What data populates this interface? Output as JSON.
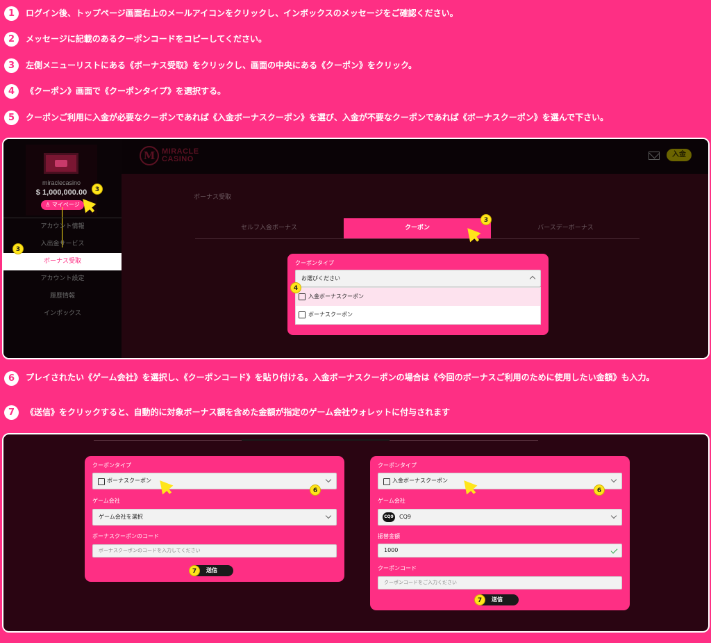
{
  "steps": [
    {
      "num": "1",
      "text": "ログイン後、トップページ画面右上のメールアイコンをクリックし、インボックスのメッセージをご確認ください。"
    },
    {
      "num": "2",
      "text": "メッセージに記載のあるクーポンコードをコピーしてください。"
    },
    {
      "num": "3",
      "text": "左側メニューリストにある《ボーナス受取》をクリックし、画面の中央にある《クーポン》をクリック。"
    },
    {
      "num": "4",
      "text": "《クーポン》画面で《クーポンタイプ》を選択する。"
    },
    {
      "num": "5",
      "text": "クーポンご利用に入金が必要なクーポンであれば《入金ボーナスクーポン》を選び、入金が不要なクーポンであれば《ボーナスクーポン》を選んで下さい。"
    },
    {
      "num": "6",
      "text": "プレイされたい《ゲーム会社》を選択し、《クーポンコード》を貼り付ける。入金ボーナスクーポンの場合は《今回のボーナスご利用のために使用したい金額》も入力。"
    },
    {
      "num": "7",
      "text": "《送信》をクリックすると、自動的に対象ボーナス額を含めた金額が指定のゲーム会社ウォレットに付与されます"
    }
  ],
  "screen1": {
    "brand_line1": "MIRACLE",
    "brand_line2": "CASINO",
    "deposit_label": "入金",
    "username": "miraclecasino",
    "balance": "$ 1,000,000.00",
    "mypage_label": "♙ マイページ",
    "menu": [
      "アカウント情報",
      "入出金サービス",
      "ボーナス受取",
      "アカウント設定",
      "履歴情報",
      "インボックス"
    ],
    "page_title": "ボーナス受取",
    "tabs": [
      "セルフ入金ボーナス",
      "クーポン",
      "バースデーボーナス"
    ],
    "coupon_type_label": "クーポンタイプ",
    "select_placeholder": "お選びください",
    "options": [
      "入金ボーナスクーポン",
      "ボーナスクーポン"
    ],
    "badges": {
      "profile": "3",
      "menu": "3",
      "tab": "3",
      "dropdown": "4"
    }
  },
  "screen2": {
    "left": {
      "coupon_type_label": "クーポンタイプ",
      "coupon_type_value": "ボーナスクーポン",
      "game_label": "ゲーム会社",
      "game_value": "ゲーム会社を選択",
      "code_label": "ボーナスクーポンのコード",
      "code_placeholder": "ボーナスクーポンのコードを入力してください",
      "send_label": "送信",
      "badge_select": "6",
      "badge_send": "7"
    },
    "right": {
      "coupon_type_label": "クーポンタイプ",
      "coupon_type_value": "入金ボーナスクーポン",
      "game_label": "ゲーム会社",
      "game_logo": "CQ9",
      "game_value": "CQ9",
      "amount_label": "振替金額",
      "amount_value": "1000",
      "code_label": "クーポンコード",
      "code_placeholder": "クーポンコードをご入力ください",
      "send_label": "送信",
      "badge_select": "6",
      "badge_send": "7"
    }
  }
}
